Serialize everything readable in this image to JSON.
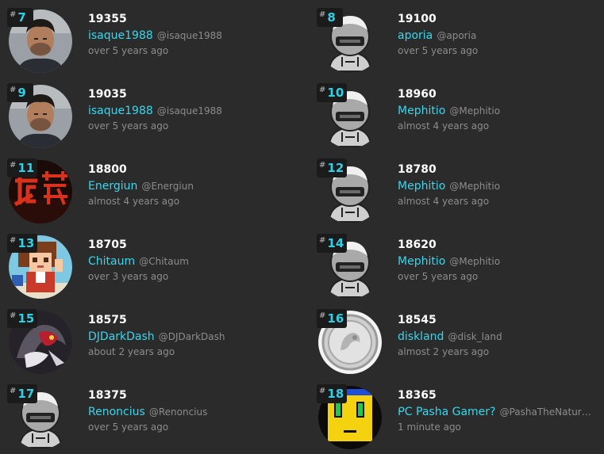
{
  "entries": [
    {
      "rank": "7",
      "hash": "#",
      "score": "19355",
      "name": "isaque1988",
      "handle": "@isaque1988",
      "time": "over 5 years ago",
      "avatar": "person-photo-avatar"
    },
    {
      "rank": "8",
      "hash": "#",
      "score": "19100",
      "name": "aporia",
      "handle": "@aporia",
      "time": "over 5 years ago",
      "avatar": "default-robot-avatar"
    },
    {
      "rank": "9",
      "hash": "#",
      "score": "19035",
      "name": "isaque1988",
      "handle": "@isaque1988",
      "time": "over 5 years ago",
      "avatar": "person-photo-avatar"
    },
    {
      "rank": "10",
      "hash": "#",
      "score": "18960",
      "name": "Mephitio",
      "handle": "@Mephitio",
      "time": "almost 4 years ago",
      "avatar": "default-robot-avatar"
    },
    {
      "rank": "11",
      "hash": "#",
      "score": "18800",
      "name": "Energiun",
      "handle": "@Energiun",
      "time": "almost 4 years ago",
      "avatar": "red-kanji-avatar"
    },
    {
      "rank": "12",
      "hash": "#",
      "score": "18780",
      "name": "Mephitio",
      "handle": "@Mephitio",
      "time": "almost 4 years ago",
      "avatar": "default-robot-avatar"
    },
    {
      "rank": "13",
      "hash": "#",
      "score": "18705",
      "name": "Chitaum",
      "handle": "@Chitaum",
      "time": "over 3 years ago",
      "avatar": "pixel-girl-avatar"
    },
    {
      "rank": "14",
      "hash": "#",
      "score": "18620",
      "name": "Mephitio",
      "handle": "@Mephitio",
      "time": "over 5 years ago",
      "avatar": "default-robot-avatar"
    },
    {
      "rank": "15",
      "hash": "#",
      "score": "18575",
      "name": "DJDarkDash",
      "handle": "@DJDarkDash",
      "time": "about 2 years ago",
      "avatar": "dark-creature-avatar"
    },
    {
      "rank": "16",
      "hash": "#",
      "score": "18545",
      "name": "diskland",
      "handle": "@disk_land",
      "time": "almost 2 years ago",
      "avatar": "silver-coin-avatar"
    },
    {
      "rank": "17",
      "hash": "#",
      "score": "18375",
      "name": "Renoncius",
      "handle": "@Renoncius",
      "time": "over 5 years ago",
      "avatar": "default-robot-avatar"
    },
    {
      "rank": "18",
      "hash": "#",
      "score": "18365",
      "name": "ᑭC Pasha Gamer?",
      "handle": "@PashaTheNatur…",
      "time": "1 minute ago",
      "avatar": "yellow-pixel-face-avatar"
    }
  ],
  "colors": {
    "background": "#2c2b2b",
    "rank_badge": "#1b1b1b",
    "rank_number": "#2fd0e6",
    "username": "#34d8ef",
    "muted": "#8c8c8c",
    "score": "#ffffff"
  }
}
